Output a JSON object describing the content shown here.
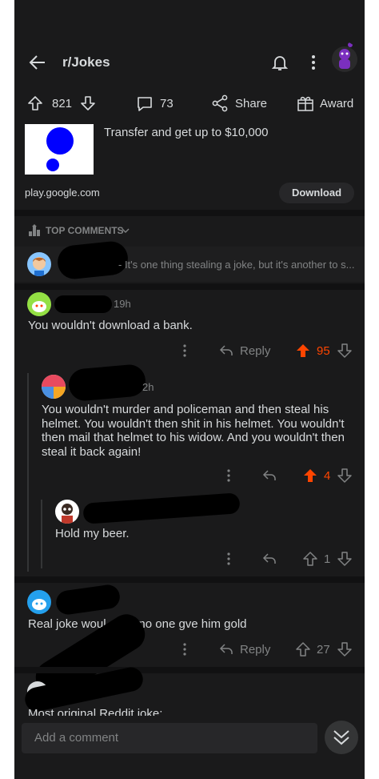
{
  "header": {
    "title": "r/Jokes"
  },
  "post_actions": {
    "upvotes": "821",
    "comments": "73",
    "share_label": "Share",
    "award_label": "Award"
  },
  "ad": {
    "headline": "Transfer and get up to $10,000",
    "domain": "play.google.com",
    "download_label": "Download",
    "accent_color": "#0000ff"
  },
  "comments_header": {
    "label": "TOP COMMENTS"
  },
  "comments": {
    "collapsed_preview": "- It's one thing stealing a joke, but it's another to s...",
    "c1": {
      "time": "19h",
      "body": "You wouldn't download a bank.",
      "reply_label": "Reply",
      "score": "95"
    },
    "c2": {
      "time": "2h",
      "body": "You wouldn't murder and policeman and then steal his helmet. You wouldn't then shit in his helmet. You wouldn't then mail that helmet to his widow. And you wouldn't then steal it back again!",
      "score": "4"
    },
    "c3": {
      "body": "Hold my beer.",
      "score": "1"
    },
    "c4": {
      "body": "Real joke woul  oe if no one gve him gold",
      "reply_label": "Reply",
      "score": "27"
    },
    "c5": {
      "body": "Most original Reddit joke:"
    }
  },
  "composer": {
    "placeholder": "Add a comment"
  },
  "colors": {
    "upvote_active": "#ff4500",
    "background": "#1a1a1b",
    "text": "#d7dadc",
    "muted": "#818384"
  }
}
